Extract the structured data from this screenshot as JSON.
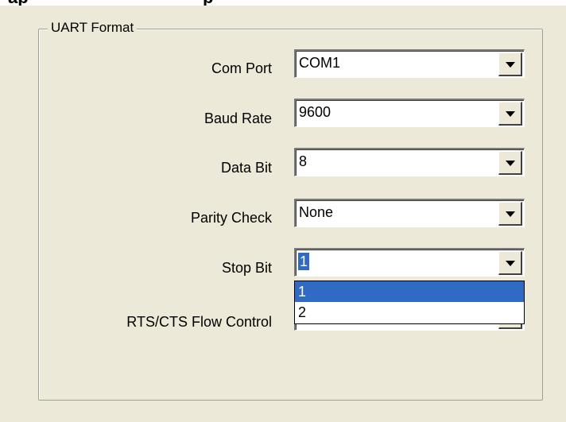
{
  "uart_format": {
    "title": "UART Format",
    "fields": [
      {
        "label": "Com Port",
        "value": "COM1"
      },
      {
        "label": "Baud Rate",
        "value": "9600"
      },
      {
        "label": "Data Bit",
        "value": "8"
      },
      {
        "label": "Parity Check",
        "value": "None"
      },
      {
        "label": "Stop Bit",
        "value": "1"
      },
      {
        "label": "RTS/CTS Flow Control",
        "value": ""
      }
    ],
    "stop_bit_dropdown": {
      "options": [
        "1",
        "2"
      ],
      "highlighted": "1"
    }
  },
  "colors": {
    "panel_bg": "#ece9d8",
    "selection": "#316ac5"
  }
}
